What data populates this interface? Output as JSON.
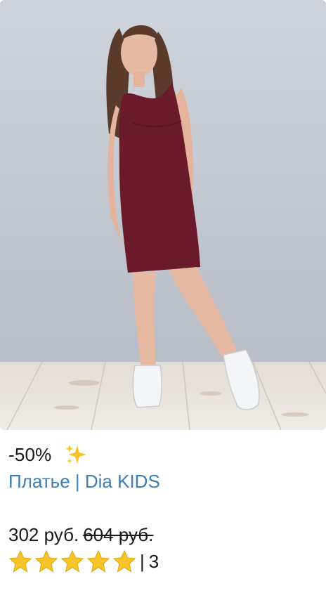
{
  "product": {
    "image_alt": "Girl in a burgundy sleeveless dress",
    "discount": "-50%",
    "sparkles_icon": "sparkles-icon",
    "title": "Платье | Dia KIDS",
    "price_current": "302 руб.",
    "price_old": "604 руб.",
    "rating_stars": 5,
    "rating_separator": "|",
    "review_count": "3"
  },
  "colors": {
    "link": "#3a7fb7",
    "dress": "#6b1a2a",
    "wall": "#c5c9d2",
    "star": "#f7c52b"
  }
}
